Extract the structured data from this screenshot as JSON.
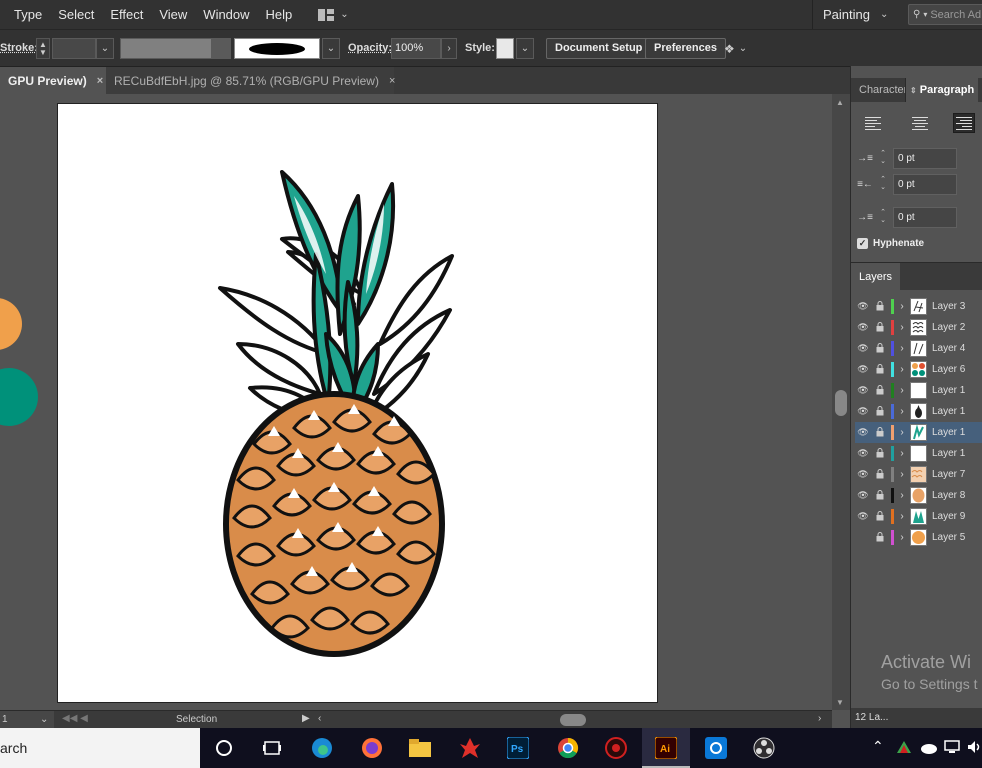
{
  "menu": {
    "items": [
      "Type",
      "Select",
      "Effect",
      "View",
      "Window",
      "Help"
    ],
    "workspace_label": "Painting",
    "search_placeholder": "Search Ad"
  },
  "control_bar": {
    "stroke_label": "Stroke:",
    "opacity_label": "Opacity:",
    "opacity_value": "100%",
    "style_label": "Style:",
    "document_setup_label": "Document Setup",
    "preferences_label": "Preferences"
  },
  "tabs": {
    "active_label": "GPU Preview)",
    "inactive_label": "RECuBdfEbH.jpg @ 85.71% (RGB/GPU Preview)",
    "close_glyph": "×"
  },
  "status_bar": {
    "zoom_value": "1",
    "status_text": "Selection"
  },
  "paragraph_panel": {
    "tab_character": "Character",
    "tab_paragraph": "Paragraph",
    "indent_left": "0 pt",
    "indent_right": "0 pt",
    "indent_first": "0 pt",
    "hyphenate_label": "Hyphenate"
  },
  "layers_panel": {
    "tab_label": "Layers",
    "footer_count": "12 La...",
    "layers": [
      {
        "name": "Layer 3",
        "color": "#4fd04f",
        "visible": true,
        "thumb": "lines"
      },
      {
        "name": "Layer 2",
        "color": "#e04040",
        "visible": true,
        "thumb": "scales"
      },
      {
        "name": "Layer 4",
        "color": "#5050e0",
        "visible": true,
        "thumb": "leaves"
      },
      {
        "name": "Layer 6",
        "color": "#40e0e0",
        "visible": true,
        "thumb": "dots"
      },
      {
        "name": "Layer 1",
        "color": "#208020",
        "visible": true,
        "thumb": "blank"
      },
      {
        "name": "Layer 1",
        "color": "#4a6ad8",
        "visible": true,
        "thumb": "pineapple"
      },
      {
        "name": "Layer 1",
        "color": "#f0a070",
        "visible": true,
        "thumb": "crown"
      },
      {
        "name": "Layer 1",
        "color": "#20a0a0",
        "visible": true,
        "thumb": "blank"
      },
      {
        "name": "Layer 7",
        "color": "#808080",
        "visible": true,
        "thumb": "orange-scales"
      },
      {
        "name": "Layer 8",
        "color": "#101010",
        "visible": true,
        "thumb": "orange"
      },
      {
        "name": "Layer 9",
        "color": "#e07020",
        "visible": true,
        "thumb": "green-crown"
      },
      {
        "name": "Layer 5",
        "color": "#d050d0",
        "visible": false,
        "thumb": "orange-circle"
      }
    ]
  },
  "watermark": {
    "title": "Activate Wi",
    "subtitle": "Go to Settings t"
  },
  "taskbar": {
    "search_text": "arch"
  },
  "colors": {
    "orange": "#f0a04b",
    "teal": "#00917a",
    "pineapple_body": "#d98c4a",
    "pineapple_crown": "#1fa38e"
  }
}
